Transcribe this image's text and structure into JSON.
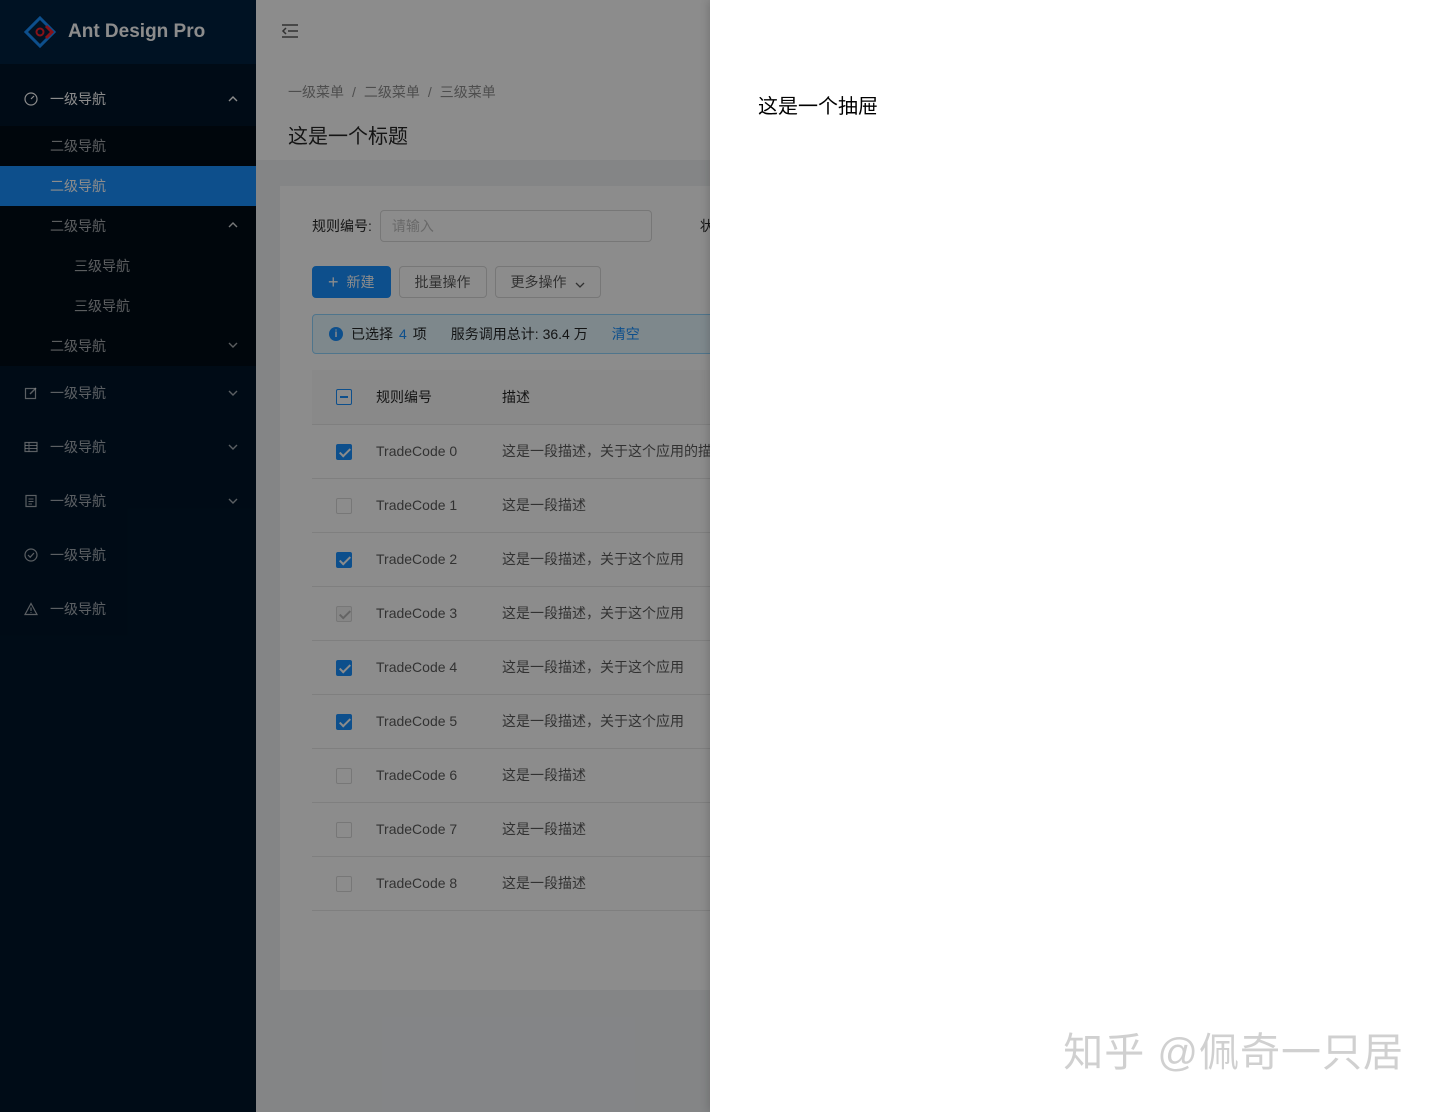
{
  "app": {
    "title": "Ant Design Pro"
  },
  "sidebar": {
    "open_menu": {
      "label": "一级导航"
    },
    "sub_items": [
      {
        "label": "二级导航"
      },
      {
        "label": "二级导航"
      },
      {
        "label": "二级导航"
      },
      {
        "label": "三级导航"
      },
      {
        "label": "三级导航"
      },
      {
        "label": "二级导航"
      }
    ],
    "menus": [
      {
        "label": "一级导航",
        "icon": "edit-icon"
      },
      {
        "label": "一级导航",
        "icon": "table-icon"
      },
      {
        "label": "一级导航",
        "icon": "profile-icon"
      },
      {
        "label": "一级导航",
        "icon": "check-circle-icon"
      },
      {
        "label": "一级导航",
        "icon": "warning-icon"
      }
    ]
  },
  "breadcrumb": [
    "一级菜单",
    "二级菜单",
    "三级菜单"
  ],
  "breadcrumb_sep": "/",
  "page": {
    "title": "这是一个标题"
  },
  "filter": {
    "rule_label": "规则编号:",
    "rule_placeholder": "请输入",
    "status_label": "状"
  },
  "toolbar": {
    "new_label": "新建",
    "batch_label": "批量操作",
    "more_label": "更多操作"
  },
  "alert": {
    "selected_prefix": "已选择",
    "selected_count": "4",
    "selected_suffix": "项",
    "total_text": "服务调用总计: 36.4 万",
    "clear_label": "清空"
  },
  "table": {
    "columns": [
      "规则编号",
      "描述"
    ],
    "rows": [
      {
        "code": "TradeCode 0",
        "desc": "这是一段描述，关于这个应用的描述",
        "state": "checked"
      },
      {
        "code": "TradeCode 1",
        "desc": "这是一段描述",
        "state": "unchecked"
      },
      {
        "code": "TradeCode 2",
        "desc": "这是一段描述，关于这个应用",
        "state": "checked"
      },
      {
        "code": "TradeCode 3",
        "desc": "这是一段描述，关于这个应用",
        "state": "disabled"
      },
      {
        "code": "TradeCode 4",
        "desc": "这是一段描述，关于这个应用",
        "state": "checked"
      },
      {
        "code": "TradeCode 5",
        "desc": "这是一段描述，关于这个应用",
        "state": "checked"
      },
      {
        "code": "TradeCode 6",
        "desc": "这是一段描述",
        "state": "unchecked"
      },
      {
        "code": "TradeCode 7",
        "desc": "这是一段描述",
        "state": "unchecked"
      },
      {
        "code": "TradeCode 8",
        "desc": "这是一段描述",
        "state": "unchecked"
      }
    ]
  },
  "drawer": {
    "content": "这是一个抽屉"
  },
  "watermark": "知乎 @佩奇一只居",
  "colors": {
    "primary": "#1890ff",
    "sider": "#001529",
    "submenu": "#000c17"
  }
}
